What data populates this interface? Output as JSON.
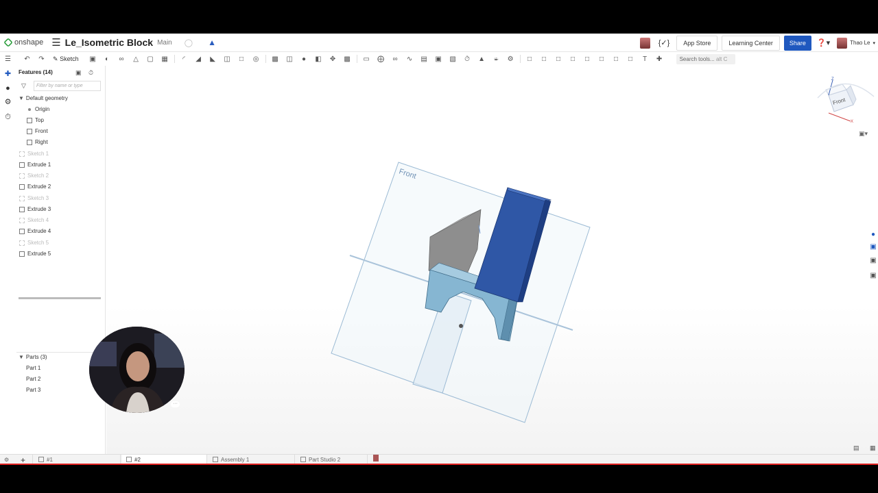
{
  "app": {
    "brand": "onshape",
    "document_title": "Le_Isometric Block",
    "branch": "Main"
  },
  "topbar": {
    "app_store": "App Store",
    "learning_center": "Learning Center",
    "share": "Share",
    "user_name": "Thao Le"
  },
  "toolbar": {
    "sketch_label": "Sketch",
    "search_tools_placeholder": "Search tools...",
    "search_shortcut": "alt C"
  },
  "features": {
    "header": "Features (14)",
    "filter_placeholder": "Filter by name or type",
    "default_geometry_label": "Default geometry",
    "default_geometry": [
      "Origin",
      "Top",
      "Front",
      "Right"
    ],
    "items": [
      {
        "label": "Sketch 1",
        "kind": "sketch"
      },
      {
        "label": "Extrude 1",
        "kind": "extrude"
      },
      {
        "label": "Sketch 2",
        "kind": "sketch"
      },
      {
        "label": "Extrude 2",
        "kind": "extrude"
      },
      {
        "label": "Sketch 3",
        "kind": "sketch"
      },
      {
        "label": "Extrude 3",
        "kind": "extrude"
      },
      {
        "label": "Sketch 4",
        "kind": "sketch"
      },
      {
        "label": "Extrude 4",
        "kind": "extrude"
      },
      {
        "label": "Sketch 5",
        "kind": "sketch"
      },
      {
        "label": "Extrude 5",
        "kind": "extrude"
      }
    ]
  },
  "parts": {
    "header": "Parts (3)",
    "items": [
      "Part 1",
      "Part 2",
      "Part 3"
    ]
  },
  "viewport": {
    "plane_label": "Front",
    "viewcube_face": "Front",
    "viewcube_axis_z": "Z",
    "viewcube_axis_x": "X"
  },
  "tabs": [
    {
      "label": "#1"
    },
    {
      "label": "#2"
    },
    {
      "label": "Assembly 1"
    },
    {
      "label": "Part Studio 2"
    }
  ],
  "colors": {
    "brand_green": "#2a9d3b",
    "share_blue": "#1f58bf",
    "part_blue": "#2e55a8",
    "part_lightblue": "#7fb0cf",
    "part_gray": "#8c8c8c"
  }
}
